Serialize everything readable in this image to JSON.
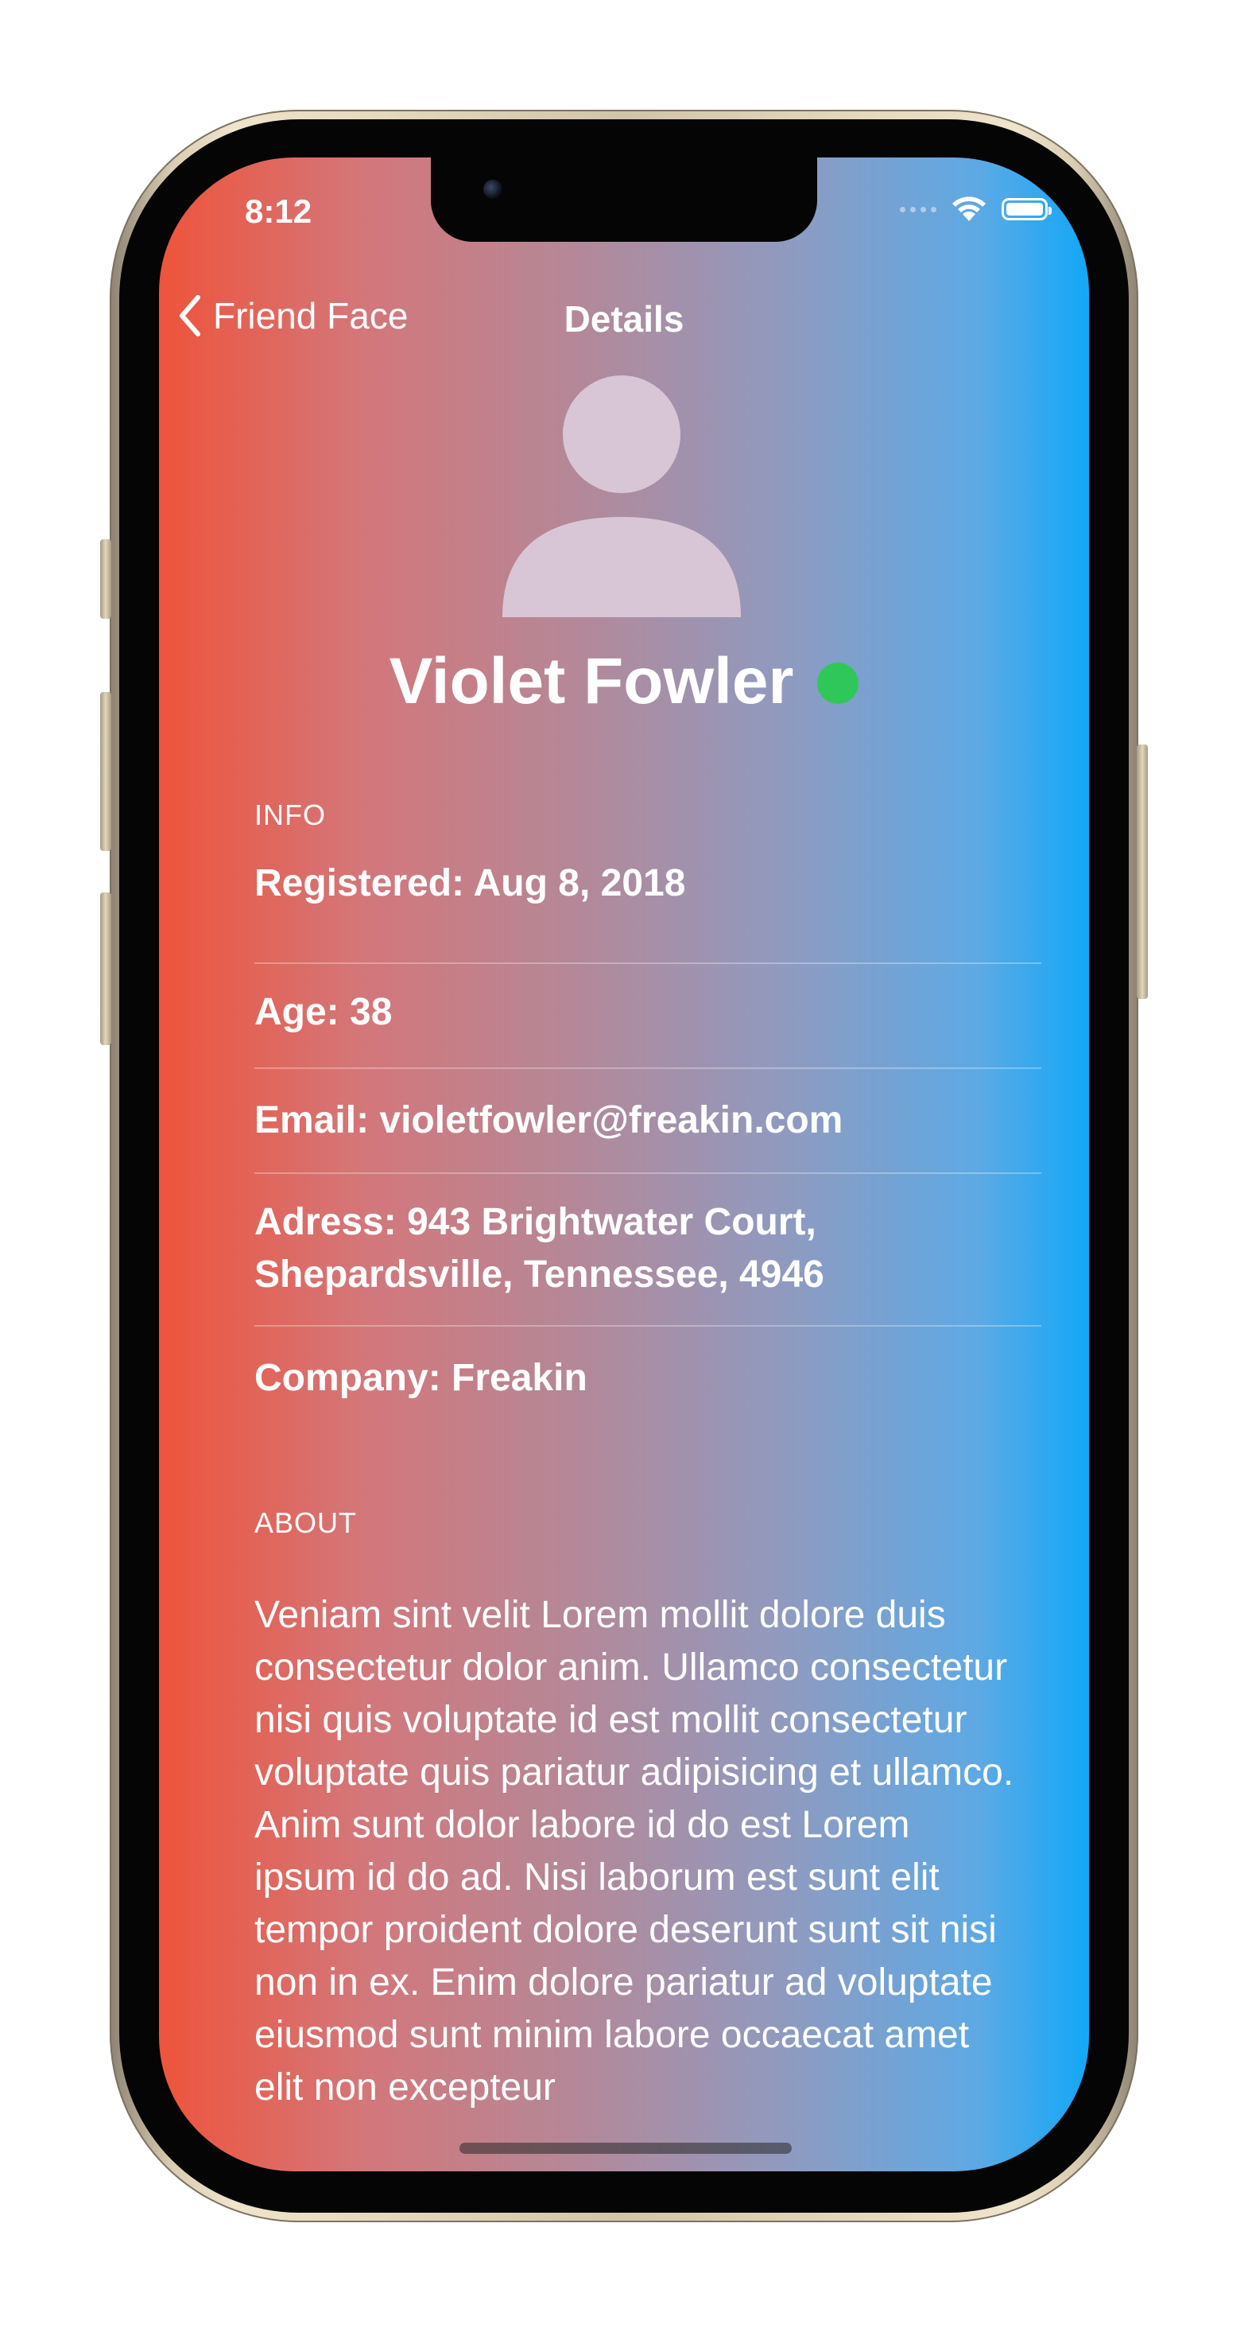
{
  "status_bar": {
    "time": "8:12"
  },
  "nav": {
    "back_label": "Friend Face",
    "title": "Details"
  },
  "profile": {
    "name": "Violet Fowler",
    "online_color": "#30c75a"
  },
  "info": {
    "header": "INFO",
    "rows": [
      "Registered: Aug 8, 2018",
      "Age: 38",
      "Email: violetfowler@freakin.com",
      "Adress: 943 Brightwater Court, Shepardsville, Tennessee, 4946",
      "Company: Freakin"
    ]
  },
  "about": {
    "header": "ABOUT",
    "text": "Veniam sint velit Lorem mollit dolore duis consectetur dolor anim. Ullamco consectetur nisi quis voluptate id est mollit consectetur voluptate quis pariatur adipisicing et ullamco. Anim sunt dolor labore id do est Lorem ipsum id do ad. Nisi laborum est sunt elit tempor proident dolore deserunt sunt sit nisi non in ex. Enim dolore pariatur ad voluptate eiusmod sunt minim labore occaecat amet elit non excepteur"
  },
  "icons": [
    "chevron-left-icon",
    "wifi-icon",
    "battery-icon",
    "person-icon",
    "online-status-icon"
  ],
  "colors": {
    "gradient_left": "#ee543b",
    "gradient_right": "#12a8f7",
    "text": "#ffffff"
  }
}
